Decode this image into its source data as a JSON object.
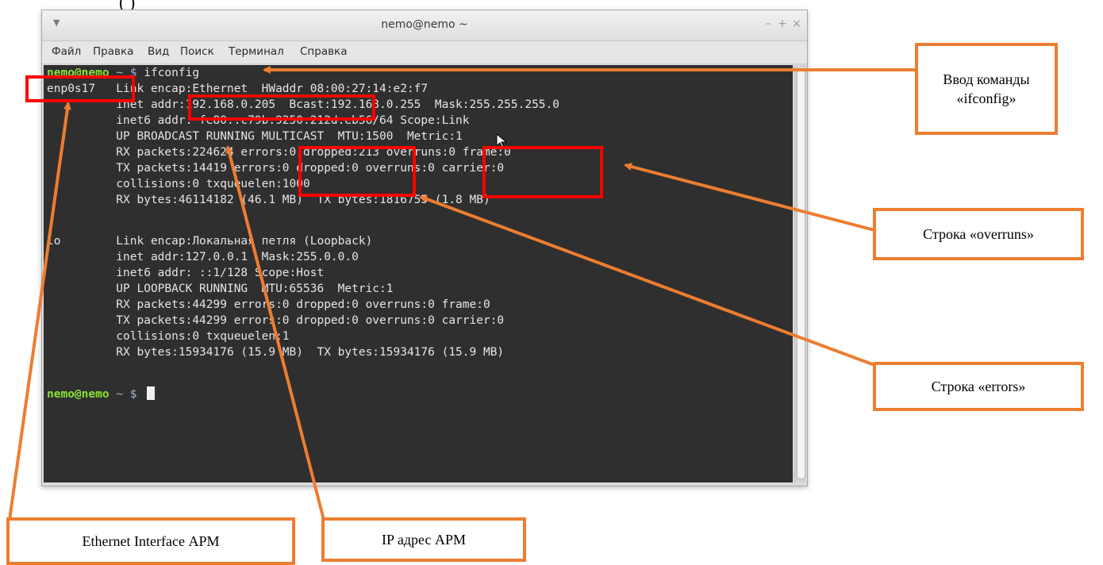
{
  "fragment": "(       )",
  "window": {
    "title": "nemo@nemo ~",
    "menu_icon": "▼",
    "minimize": "–",
    "maximize": "+",
    "close": "×"
  },
  "menubar": {
    "items": [
      "Файл",
      "Правка",
      "Вид",
      "Поиск",
      "Терминал",
      "Справка"
    ]
  },
  "terminal": {
    "prompt_user": "nemo@nemo",
    "prompt_sep": " ~ $ ",
    "command": "ifconfig",
    "lines": [
      "enp0s17   Link encap:Ethernet  HWaddr 08:00:27:14:e2:f7",
      "          inet addr:192.168.0.205  Bcast:192.168.0.255  Mask:255.255.255.0",
      "          inet6 addr: fe80::c79b:9250:212d:eb56/64 Scope:Link",
      "          UP BROADCAST RUNNING MULTICAST  MTU:1500  Metric:1",
      "          RX packets:224624 errors:0 dropped:213 overruns:0 frame:0",
      "          TX packets:14419 errors:0 dropped:0 overruns:0 carrier:0",
      "          collisions:0 txqueuelen:1000",
      "          RX bytes:46114182 (46.1 MB)  TX bytes:1816755 (1.8 MB)",
      "",
      "lo        Link encap:Локальная петля (Loopback)",
      "          inet addr:127.0.0.1  Mask:255.0.0.0",
      "          inet6 addr: ::1/128 Scope:Host",
      "          UP LOOPBACK RUNNING  MTU:65536  Metric:1",
      "          RX packets:44299 errors:0 dropped:0 overruns:0 frame:0",
      "          TX packets:44299 errors:0 dropped:0 overruns:0 carrier:0",
      "          collisions:0 txqueuelen:1",
      "          RX bytes:15934176 (15.9 MB)  TX bytes:15934176 (15.9 MB)"
    ]
  },
  "callouts": {
    "command_input": "Ввод команды «ifconfig»",
    "overruns": "Строка «overruns»",
    "errors": "Строка «errors»",
    "ethernet": "Ethernet Interface АРМ",
    "ip": "IP адрес АРМ"
  },
  "colors": {
    "annotation_red": "#ff0000",
    "annotation_orange": "#ed7d31",
    "prompt_green": "#8ae234",
    "terminal_bg": "#2f2f2f"
  }
}
